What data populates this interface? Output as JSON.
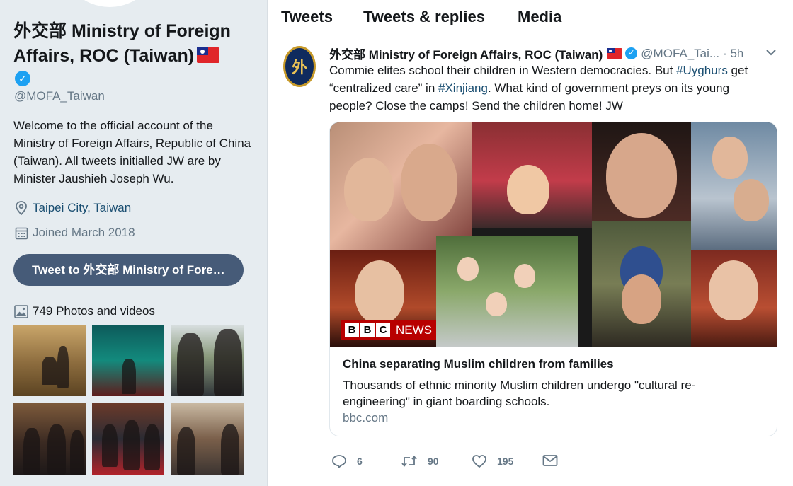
{
  "profile": {
    "name": "外交部 Ministry of Foreign Affairs, ROC (Taiwan)",
    "handle": "@MOFA_Taiwan",
    "bio": "Welcome to the official account of the Ministry of Foreign Affairs, Republic of China (Taiwan). All tweets initialled JW are by Minister Jaushieh Joseph Wu.",
    "location": "Taipei City, Taiwan",
    "joined": "Joined March 2018",
    "tweet_to_label": "Tweet to 外交部 Ministry of Foreign Affairs, ROC (Taiwan)",
    "photos_label": "749 Photos and videos",
    "icons": {
      "verified": "verified-badge-icon",
      "location": "location-pin-icon",
      "calendar": "calendar-icon",
      "photos": "image-icon"
    }
  },
  "tabs": [
    "Tweets",
    "Tweets & replies",
    "Media"
  ],
  "tweet": {
    "author_name": "外交部 Ministry of Foreign Affairs, ROC (Taiwan)",
    "author_handle": "@MOFA_Tai...",
    "time": "· 5h",
    "avatar_glyph": "外",
    "text_parts": {
      "p1": "Commie elites school their children in Western democracies. But ",
      "tag1": "#Uyghurs",
      "p2": " get “centralized care” in ",
      "tag2": "#Xinjiang",
      "p3": ". What kind of government preys on its young people? Close the camps! Send the children home! JW"
    },
    "card": {
      "image_badge": {
        "letters": [
          "B",
          "B",
          "C"
        ],
        "word": "NEWS"
      },
      "title": "China separating Muslim children from families",
      "description": "Thousands of ethnic minority Muslim children undergo \"cultural re-engineering\" in giant boarding schools.",
      "domain": "bbc.com"
    },
    "actions": {
      "replies": "6",
      "retweets": "90",
      "likes": "195"
    }
  },
  "colors": {
    "accent": "#1da1f2",
    "link": "#1b4f72",
    "button": "#465b78",
    "muted": "#657786"
  }
}
